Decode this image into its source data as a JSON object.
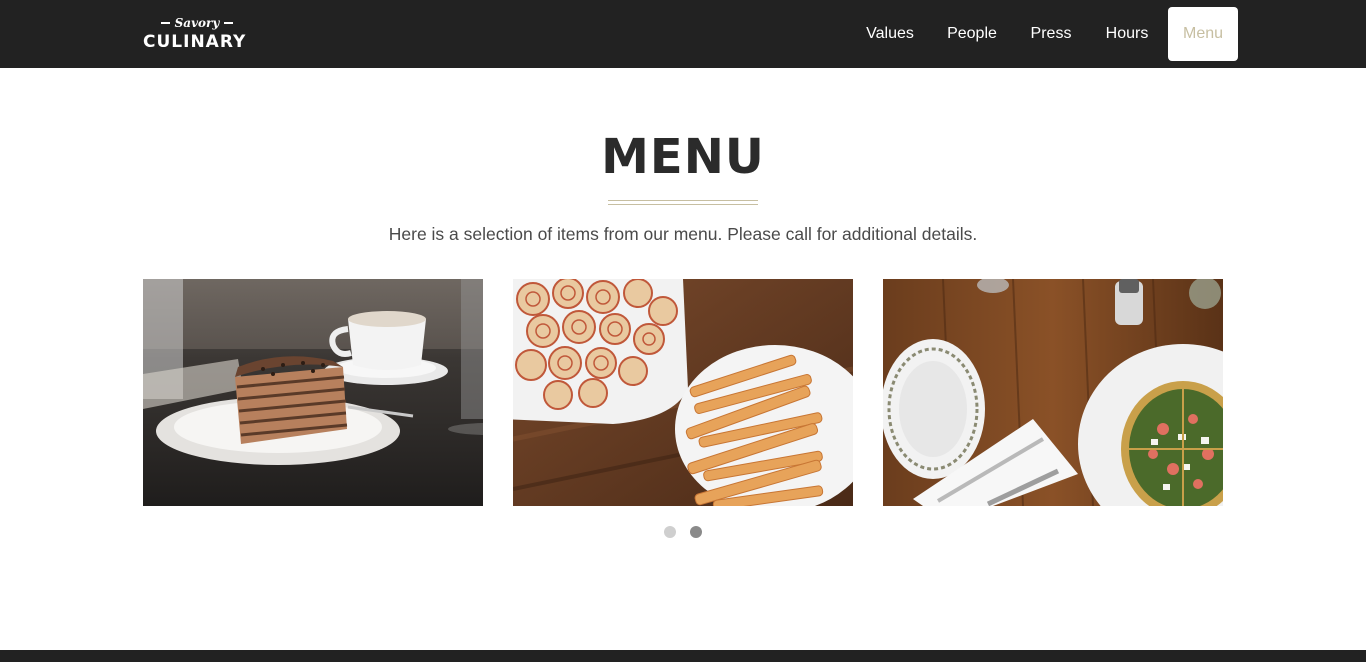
{
  "brand": {
    "script_word": "Savory",
    "name": "CULINARY"
  },
  "nav": {
    "items": [
      {
        "label": "Values",
        "active": false
      },
      {
        "label": "People",
        "active": false
      },
      {
        "label": "Press",
        "active": false
      },
      {
        "label": "Hours",
        "active": false
      },
      {
        "label": "Menu",
        "active": true
      }
    ]
  },
  "section": {
    "title": "MENU",
    "subtitle": "Here is a selection of items from our menu. Please call for additional details."
  },
  "carousel": {
    "photos": [
      "layer-cake-with-coffee-photo",
      "pinwheels-and-cheese-straws-photo",
      "pizza-on-wooden-table-photo"
    ],
    "page_count": 2,
    "active_page": 2
  },
  "colors": {
    "navbar": "#222222",
    "accent": "#c7bfa2",
    "text": "#2b2b2b",
    "dot_inactive": "#cfcfcf",
    "dot_active": "#8a8a8a"
  }
}
